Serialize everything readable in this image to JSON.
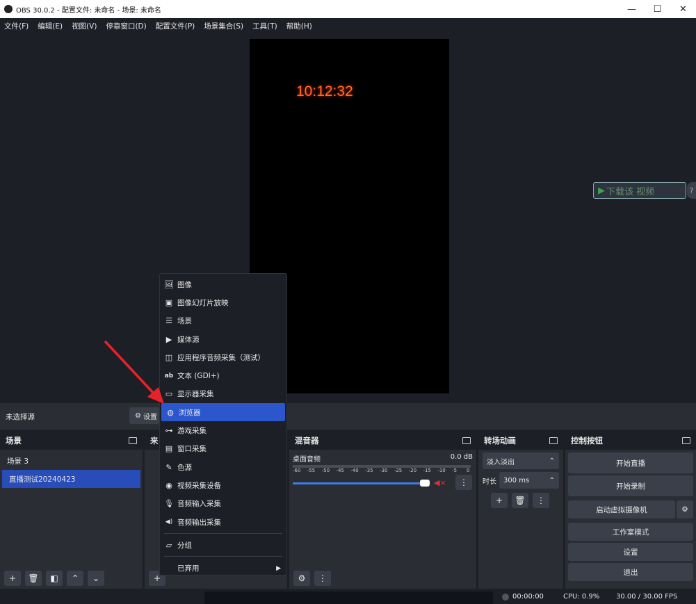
{
  "window": {
    "title": "OBS 30.0.2 - 配置文件: 未命名 - 场景: 未命名",
    "minimize": "—",
    "maximize": "☐",
    "close": "✕"
  },
  "menubar": [
    "文件(F)",
    "编辑(E)",
    "视图(V)",
    "停靠窗口(D)",
    "配置文件(P)",
    "场景集合(S)",
    "工具(T)",
    "帮助(H)"
  ],
  "preview": {
    "clock": "10:12:32",
    "download_button": "下载该 视频",
    "download_help": "?"
  },
  "source_bar": {
    "no_selection": "未选择源",
    "settings": "设置"
  },
  "scenes": {
    "title": "场景",
    "items": [
      "场景 3",
      "直播测试20240423"
    ],
    "selected_index": 1
  },
  "sources": {
    "title": "来"
  },
  "mixer": {
    "title": "混音器",
    "track_name": "桌面音频",
    "level": "0.0 dB",
    "scale": [
      "-60",
      "-55",
      "-50",
      "-45",
      "-40",
      "-35",
      "-30",
      "-25",
      "-20",
      "-15",
      "-10",
      "-5",
      "0"
    ]
  },
  "transitions": {
    "title": "转场动画",
    "type": "淡入淡出",
    "duration_label": "时长",
    "duration_value": "300 ms"
  },
  "controls": {
    "title": "控制按钮",
    "buttons": [
      "开始直播",
      "开始录制",
      "启动虚拟摄像机",
      "工作室模式",
      "设置",
      "退出"
    ]
  },
  "context_menu": {
    "items": [
      {
        "icon": "image-icon",
        "glyph": "🖼",
        "label": "图像"
      },
      {
        "icon": "slideshow-icon",
        "glyph": "▣",
        "label": "图像幻灯片放映"
      },
      {
        "icon": "list-icon",
        "glyph": "☰",
        "label": "场景"
      },
      {
        "icon": "play-icon",
        "glyph": "▶",
        "label": "媒体源"
      },
      {
        "icon": "app-audio-icon",
        "glyph": "◫",
        "label": "应用程序音频采集（测试）"
      },
      {
        "icon": "text-icon",
        "glyph": "ab",
        "label": "文本 (GDI+)"
      },
      {
        "icon": "monitor-icon",
        "glyph": "▭",
        "label": "显示器采集"
      },
      {
        "icon": "globe-icon",
        "glyph": "◍",
        "label": "浏览器"
      },
      {
        "icon": "gamepad-icon",
        "glyph": "⊶",
        "label": "游戏采集"
      },
      {
        "icon": "window-icon",
        "glyph": "▤",
        "label": "窗口采集"
      },
      {
        "icon": "brush-icon",
        "glyph": "✎",
        "label": "色源"
      },
      {
        "icon": "camera-icon",
        "glyph": "◉",
        "label": "视频采集设备"
      },
      {
        "icon": "mic-icon",
        "glyph": "🎙",
        "label": "音频输入采集"
      },
      {
        "icon": "speaker-icon",
        "glyph": "◀)",
        "label": "音频输出采集"
      }
    ],
    "group": {
      "icon": "folder-icon",
      "glyph": "▱",
      "label": "分组"
    },
    "deprecated": {
      "label": "已弃用",
      "arrow": "▶"
    },
    "highlighted_index": 7
  },
  "status": {
    "rec_time": "00:00:00",
    "cpu": "CPU: 0.9%",
    "fps": "30.00 / 30.00 FPS"
  },
  "colors": {
    "accent": "#284cb8",
    "highlight": "#2b56cc",
    "clock": "#ff6a2a",
    "annotation_arrow": "#e8222a"
  }
}
